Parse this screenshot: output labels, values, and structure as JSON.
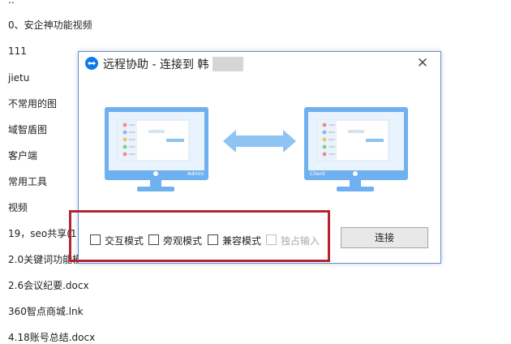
{
  "file_list": {
    "items": [
      "..",
      "0、安企神功能视频",
      "111",
      "jietu",
      "不常用的图",
      "域智盾图",
      "客户端",
      "常用工具",
      "视频",
      "19，seo共享(1",
      "2.0关键词功能模",
      "2.6会议纪要.docx",
      "360智点商城.lnk",
      "4.18账号总结.docx"
    ]
  },
  "dialog": {
    "title": "远程协助 - 连接到 韩",
    "close_glyph": "✕",
    "illustration": {
      "left_monitor_label": "Admin",
      "right_monitor_label": "Client"
    },
    "options": [
      {
        "label": "交互模式",
        "checked": false,
        "disabled": false
      },
      {
        "label": "旁观模式",
        "checked": false,
        "disabled": false
      },
      {
        "label": "兼容模式",
        "checked": false,
        "disabled": false
      },
      {
        "label": "独占输入",
        "checked": false,
        "disabled": true
      }
    ],
    "connect_label": "连接"
  },
  "colors": {
    "monitor_blue": "#6fb0f0",
    "arrow_blue": "#8ec4f2",
    "highlight_red": "#b5242f",
    "app_icon_blue": "#0e7ae8"
  }
}
